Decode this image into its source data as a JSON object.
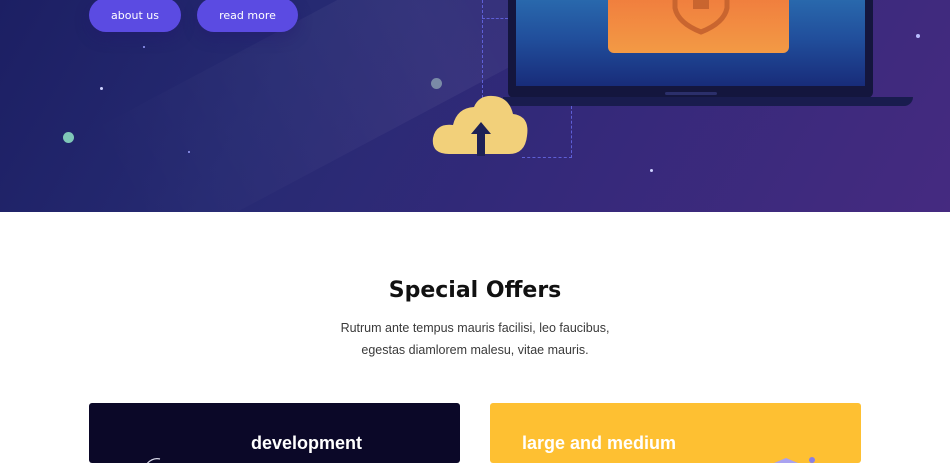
{
  "hero": {
    "buttons": {
      "about_label": "about us",
      "read_more_label": "read more"
    },
    "icons": {
      "upload": "cloud-upload-icon",
      "lock": "lock-icon",
      "shield": "shield-icon"
    }
  },
  "offers": {
    "title": "Special Offers",
    "subtitle_line1": "Rutrum ante tempus mauris facilisi, leo faucibus,",
    "subtitle_line2": "egestas diamlorem malesu, vitae mauris.",
    "cards": [
      {
        "title": "development",
        "color": "#0b0828"
      },
      {
        "title": "large and medium",
        "color": "#fec032"
      }
    ]
  },
  "colors": {
    "accent": "#5b4be2",
    "hero_start": "#1c1f63",
    "hero_end": "#452a80"
  }
}
